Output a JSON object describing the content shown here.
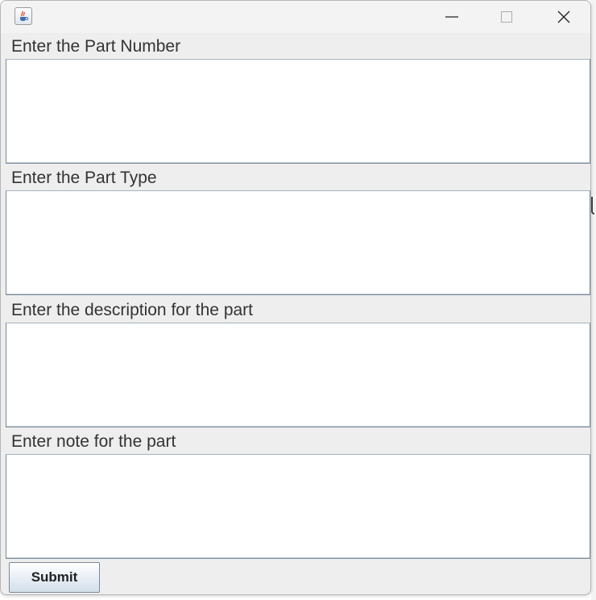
{
  "window": {
    "controls": {
      "minimize_icon": "minimize-icon",
      "maximize_icon": "maximize-icon",
      "close_icon": "close-icon"
    },
    "app_icon": "java-coffee-cup-icon"
  },
  "form": {
    "fields": [
      {
        "label": "Enter the Part Number",
        "value": ""
      },
      {
        "label": "Enter the Part Type",
        "value": ""
      },
      {
        "label": "Enter the description for the part",
        "value": ""
      },
      {
        "label": "Enter note for the part",
        "value": ""
      }
    ],
    "submit_label": "Submit"
  },
  "colors": {
    "window_bg": "#eeeeee",
    "field_border": "#7a8a99",
    "button_gradient_bottom": "#d4dfeb"
  }
}
